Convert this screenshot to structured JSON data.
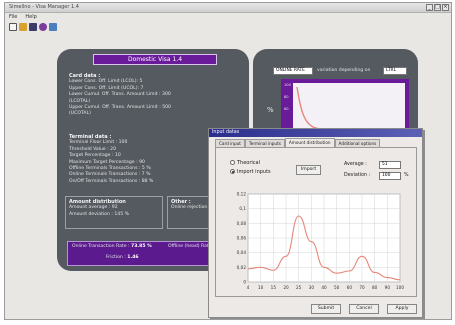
{
  "app": {
    "title": "Simellno - Visa Manager 1.4",
    "menu": [
      "File",
      "Help"
    ],
    "toolbar_icons": [
      "new-icon",
      "open-icon",
      "save-icon",
      "settings-icon",
      "help-icon"
    ]
  },
  "main_panel": {
    "title": "Domestic Visa 1.4",
    "card_data": {
      "heading": "Card data :",
      "lines": [
        "Lower Cons. Off. Limit (LCOL):  5",
        "Upper Cons. Off. Limit (UCOL):  7",
        "Lower Cumul. Off. Trans. Amount Limit :  300",
        "(LCOTAL)",
        "Upper Cumul. Off. Trans. Amount Limit :  500",
        "(UCOTAL)"
      ]
    },
    "terminal_data": {
      "heading": "Terminal data :",
      "lines": [
        "Terminal Floor Limit :  100",
        "Threshold Value :  20",
        "Target Percentage :  10",
        "Maximum Target Percentage :  90",
        "Offline Terminals Transactions :  5 %",
        "Online Terminals Transactions :  7 %",
        "On/Off Terminals Transactions :  88 %"
      ]
    },
    "amount_distribution": {
      "heading": "Amount distribution",
      "average_label": "Amount average :",
      "average_value": "92",
      "deviation_label": "Amount deviation :",
      "deviation_value": "145 %"
    },
    "other": {
      "heading": "Other :",
      "line": "Online rejection"
    },
    "results": {
      "online_label": "Online Transaction Rate :",
      "online_value": "73.85 %",
      "offline_label": "Offline (head) Rate",
      "friction_label": "Friction :",
      "friction_value": "1.46"
    }
  },
  "right_panel": {
    "select_left": "ONLINE RATE",
    "middle_label": "variation depending on",
    "select_right": "LTRL",
    "y_axis_label": "%",
    "y_ticks": [
      "100",
      "80",
      "60"
    ]
  },
  "dialog": {
    "title": "Input datas",
    "tabs": [
      "Card input",
      "Terminal inputs",
      "Amount distribution",
      "Additional options"
    ],
    "active_tab": 2,
    "theoretical_label": "Theorical",
    "import_label": "Import inputs",
    "import_button": "Import",
    "average_label": "Average :",
    "average_value": "51",
    "deviation_label": "Deviation :",
    "deviation_value": "100",
    "deviation_unit": "%",
    "submit": "Submit",
    "cancel": "Cancel",
    "apply": "Apply"
  },
  "chart_data": {
    "type": "line",
    "x_ticks": [
      "4",
      "10",
      "15",
      "20",
      "25",
      "30",
      "40",
      "50",
      "60",
      "70",
      "80",
      "90",
      "100"
    ],
    "y_ticks": [
      "0",
      "0,02",
      "0,04",
      "0,06",
      "0,08",
      "0,1",
      "0,12"
    ],
    "ylim": [
      0,
      0.12
    ],
    "grid": true,
    "series": [
      {
        "color": "#e7867a",
        "values": [
          0.018,
          0.02,
          0.016,
          0.035,
          0.09,
          0.055,
          0.02,
          0.012,
          0.015,
          0.035,
          0.013,
          0.006,
          0.003
        ]
      }
    ]
  }
}
